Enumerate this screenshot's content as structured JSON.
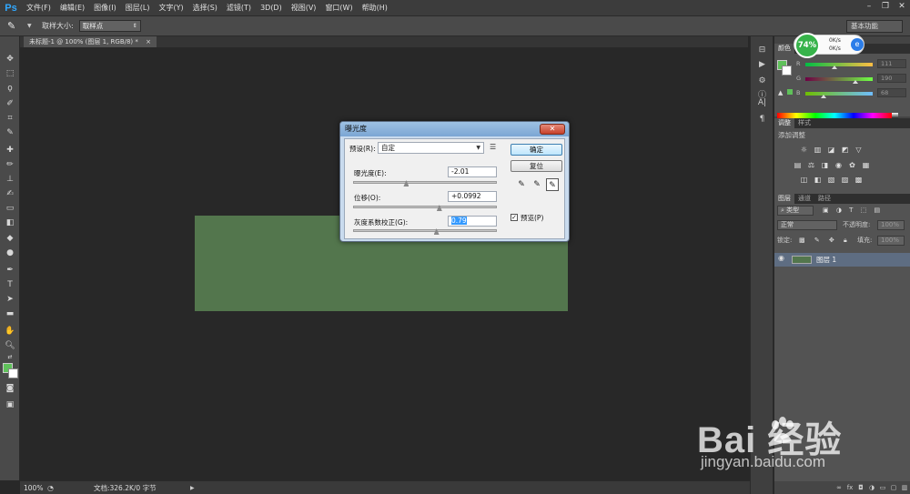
{
  "app": {
    "logo": "Ps",
    "menu": [
      "文件(F)",
      "编辑(E)",
      "图像(I)",
      "图层(L)",
      "文字(Y)",
      "选择(S)",
      "滤镜(T)",
      "3D(D)",
      "视图(V)",
      "窗口(W)",
      "帮助(H)"
    ],
    "window_controls": [
      "–",
      "❐",
      "✕"
    ]
  },
  "options_bar": {
    "sample_size_label": "取样大小:",
    "sample_size_value": "取样点",
    "workspace": "基本功能"
  },
  "document": {
    "tab_title": "未标题-1 @ 100% (图层 1, RGB/8) *",
    "tab_close": "×",
    "canvas_color": "#53764d"
  },
  "status_bar": {
    "zoom": "100%",
    "doc_info": "文档:326.2K/0 字节"
  },
  "perf_widget": {
    "percent": "74%",
    "up": "0K/s",
    "down": "0K/s"
  },
  "color_panel": {
    "tabs": [
      "颜色"
    ],
    "fg_color": "#5fc15a",
    "bg_color": "#ffffff",
    "channels": [
      {
        "label": "R",
        "value": "111",
        "fraction": 0.435
      },
      {
        "label": "G",
        "value": "190",
        "fraction": 0.745
      },
      {
        "label": "B",
        "value": "68",
        "fraction": 0.267
      }
    ]
  },
  "adjust_panel": {
    "tabs": [
      "调整",
      "样式"
    ],
    "title": "添加调整"
  },
  "layers_panel": {
    "tabs": [
      "图层",
      "通道",
      "路径"
    ],
    "filter_label": "类型",
    "blend_mode": "正常",
    "opacity_label": "不透明度:",
    "opacity_value": "100%",
    "lock_label": "锁定:",
    "fill_label": "填充:",
    "fill_value": "100%",
    "layer_name": "图层 1"
  },
  "dialog": {
    "title": "曝光度",
    "close": "✕",
    "preset_label": "预设(R):",
    "preset_value": "自定",
    "exposure_label": "曝光度(E):",
    "exposure_value": "-2.01",
    "exposure_fraction": 0.37,
    "offset_label": "位移(O):",
    "offset_value": "+0.0992",
    "offset_fraction": 0.6,
    "gamma_label": "灰度系数校正(G):",
    "gamma_value": "0.79",
    "gamma_fraction": 0.58,
    "ok_button": "确定",
    "reset_button": "复位",
    "preview_label": "预览(P)",
    "preview_checked": "✓"
  },
  "watermark": {
    "brand": "Bai  经验",
    "url": "jingyan.baidu.com"
  }
}
